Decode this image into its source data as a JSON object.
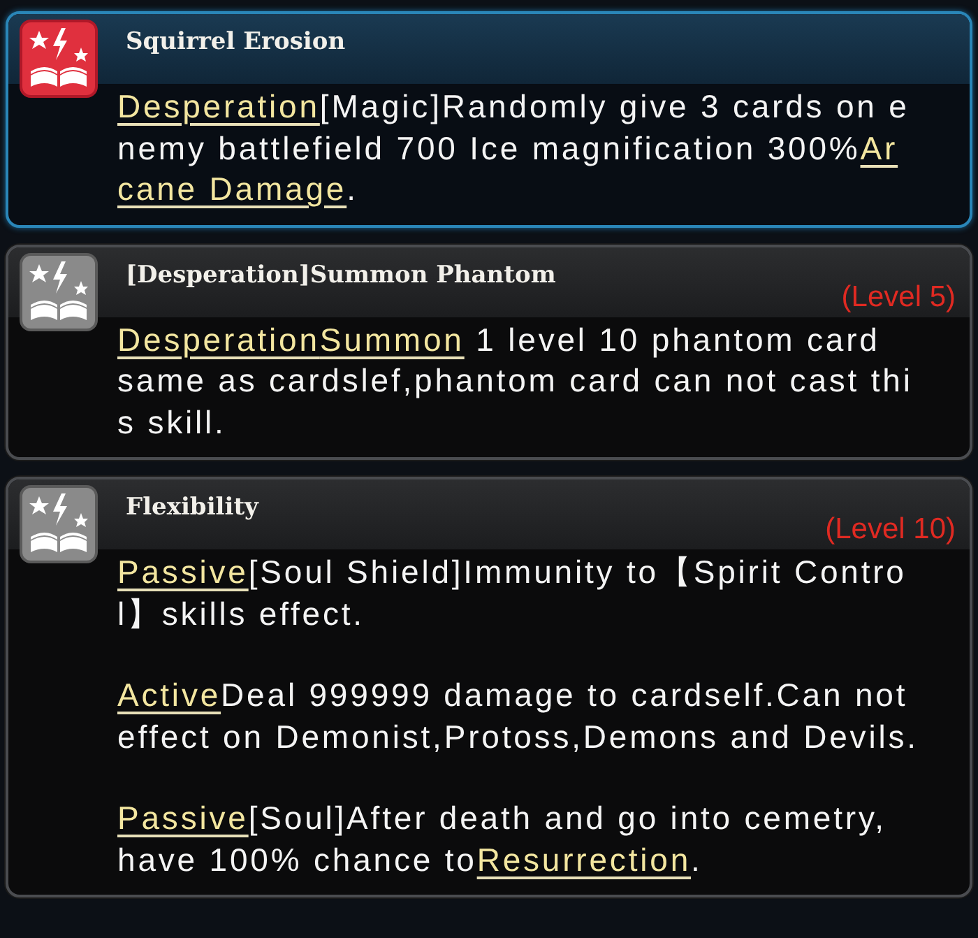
{
  "skills": [
    {
      "title": "Squirrel Erosion",
      "highlighted": true,
      "paragraphs": [
        {
          "lines": [
            [
              {
                "text": "Desperation",
                "keyword": true
              },
              {
                "text": "[Magic]Randomly give 3 cards on e",
                "keyword": false
              }
            ],
            [
              {
                "text": "nemy battlefield 700 Ice magnification 300%",
                "keyword": false
              },
              {
                "text": "Ar",
                "keyword": true
              }
            ],
            [
              {
                "text": "cane Damage",
                "keyword": true
              },
              {
                "text": ".",
                "keyword": false
              }
            ]
          ]
        }
      ]
    },
    {
      "title": "[Desperation]Summon Phantom",
      "highlighted": false,
      "level": "(Level 5)",
      "paragraphs": [
        {
          "lines": [
            [
              {
                "text": "Desperation",
                "keyword": true
              },
              {
                "text": "Summon",
                "keyword": true
              },
              {
                "text": " 1 level 10 phantom card",
                "keyword": false
              }
            ],
            [
              {
                "text": "same as cardslef,phantom card can not cast thi",
                "keyword": false
              }
            ],
            [
              {
                "text": "s skill.",
                "keyword": false
              }
            ]
          ]
        }
      ]
    },
    {
      "title": "Flexibility",
      "highlighted": false,
      "level": "(Level 10)",
      "paragraphs": [
        {
          "lines": [
            [
              {
                "text": "Passive",
                "keyword": true
              },
              {
                "text": "[Soul Shield]Immunity to【Spirit Contro",
                "keyword": false
              }
            ],
            [
              {
                "text": "l】skills effect.",
                "keyword": false
              }
            ]
          ]
        },
        {
          "lines": [
            [
              {
                "text": "Active",
                "keyword": true
              },
              {
                "text": "Deal 999999 damage to cardself.Can not",
                "keyword": false
              }
            ],
            [
              {
                "text": "effect on Demonist,Protoss,Demons and Devils.",
                "keyword": false
              }
            ]
          ]
        },
        {
          "lines": [
            [
              {
                "text": "Passive",
                "keyword": true
              },
              {
                "text": "[Soul]After death and go into cemetry,",
                "keyword": false
              }
            ],
            [
              {
                "text": "have 100% chance to",
                "keyword": false
              },
              {
                "text": "Resurrection",
                "keyword": true
              },
              {
                "text": ".",
                "keyword": false
              }
            ]
          ]
        }
      ]
    }
  ]
}
